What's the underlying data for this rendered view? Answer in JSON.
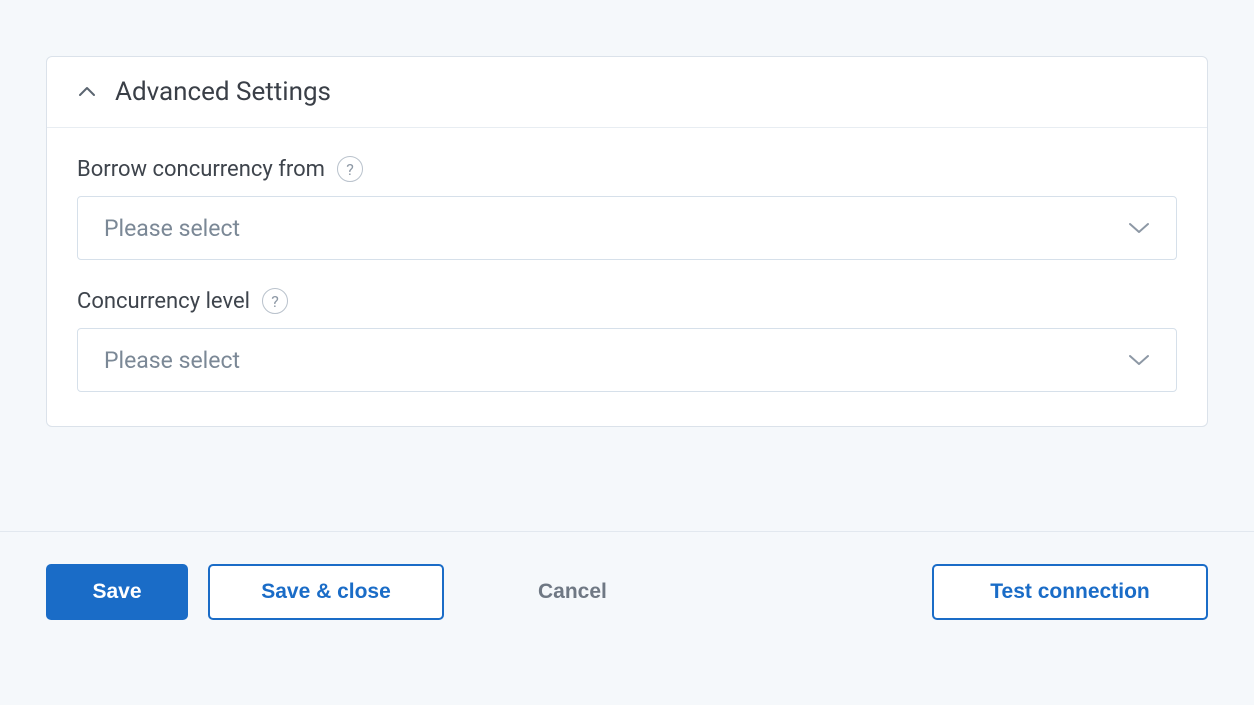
{
  "panel": {
    "title": "Advanced Settings",
    "fields": {
      "borrow_concurrency": {
        "label": "Borrow concurrency from",
        "placeholder": "Please select"
      },
      "concurrency_level": {
        "label": "Concurrency level",
        "placeholder": "Please select"
      }
    }
  },
  "help_glyph": "?",
  "footer": {
    "save": "Save",
    "save_close": "Save & close",
    "cancel": "Cancel",
    "test_connection": "Test connection"
  }
}
